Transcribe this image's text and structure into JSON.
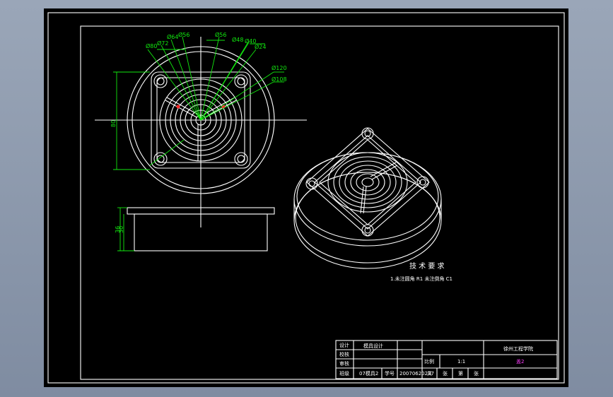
{
  "drawing": {
    "dimensions_plan": [
      "Ø80",
      "Ø72",
      "Ø64",
      "Ø56",
      "Ø56",
      "Ø48",
      "Ø40",
      "Ø24",
      "Ø120",
      "Ø108"
    ],
    "dimension_height": "80",
    "dimensions_side": [
      "36",
      "30"
    ],
    "tech_title": "技 术 要 求",
    "tech_note": "1.未注圆角 R1  未注倒角 C1"
  },
  "title_block": {
    "r1": "设计",
    "r1_value": "模具设计",
    "r2": "校核",
    "r3": "审核",
    "r4": "班级",
    "r4_class": "07模具2",
    "r4_id_label": "学号",
    "r4_id": "20070620237",
    "ratio_label": "比例",
    "ratio": "1:1",
    "school": "徐州工程学院",
    "part": "盖2",
    "bottom_cells": [
      "共",
      "张",
      "第",
      "张"
    ]
  }
}
